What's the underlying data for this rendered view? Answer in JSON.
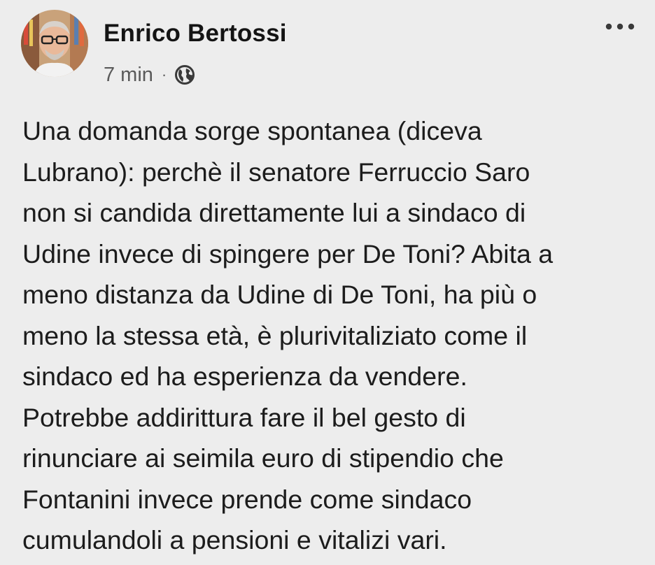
{
  "post": {
    "author": "Enrico Bertossi",
    "timestamp": "7 min",
    "separator": "·",
    "audience_icon": "globe-icon",
    "menu_icon": "more-horizontal-icon",
    "body_lines": [
      "Una domanda sorge spontanea (diceva",
      "Lubrano): perchè il senatore Ferruccio Saro",
      "non si candida direttamente lui a sindaco di",
      "Udine invece di spingere per De Toni? Abita a",
      "meno distanza da Udine di De Toni, ha più o",
      "meno la stessa età, è  plurivitaliziato come il",
      "sindaco ed ha esperienza da vendere.",
      "Potrebbe addirittura fare il bel gesto di",
      "rinunciare ai seimila euro di stipendio che",
      "Fontanini invece prende come sindaco",
      "cumulandoli a pensioni e vitalizi vari."
    ]
  },
  "colors": {
    "background": "#ededed",
    "text": "#1c1c1c",
    "meta_text": "#5a5a5a"
  }
}
